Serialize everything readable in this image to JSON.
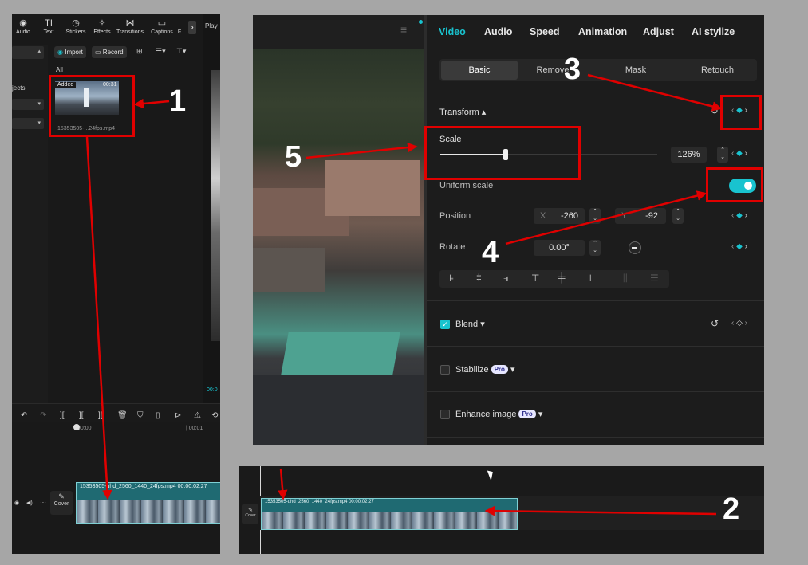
{
  "left_panel": {
    "toolbar": [
      {
        "label": "Audio",
        "icon": "audio-icon",
        "glyph": "◉"
      },
      {
        "label": "Text",
        "icon": "text-icon",
        "glyph": "TI"
      },
      {
        "label": "Stickers",
        "icon": "stickers-icon",
        "glyph": "◷"
      },
      {
        "label": "Effects",
        "icon": "effects-icon",
        "glyph": "✧"
      },
      {
        "label": "Transitions",
        "icon": "transitions-icon",
        "glyph": "⋈"
      },
      {
        "label": "Captions",
        "icon": "captions-icon",
        "glyph": "▭"
      },
      {
        "label": "F",
        "icon": "filters-icon",
        "glyph": ""
      }
    ],
    "next_glyph": "›",
    "import_label": "Import",
    "record_label": "Record",
    "all_label": "All",
    "sidebar_text": "jects",
    "player_label": "Play",
    "clip_badge": "Added",
    "clip_duration": "00:31",
    "clip_name": "15353505-...24fps.mp4",
    "timeline_time_start": "00:00",
    "timeline_time_next": "| 00:01",
    "player_time": "00:0",
    "cover_label": "Cover",
    "track_clip_label": "15353505-uhd_2560_1440_24fps.mp4  00:00:02:27"
  },
  "right_panel": {
    "tabs": [
      "Video",
      "Audio",
      "Speed",
      "Animation",
      "Adjust",
      "AI stylize"
    ],
    "active_tab": "Video",
    "subtabs": [
      "Basic",
      "Remove",
      "Mask",
      "Retouch"
    ],
    "active_subtab": "Basic",
    "transform_label": "Transform ▴",
    "scale_label": "Scale",
    "scale_value": "126%",
    "scale_level": 0.3,
    "uniform_scale_label": "Uniform scale",
    "uniform_scale_on": true,
    "position_label": "Position",
    "position_x_label": "X",
    "position_x": "-260",
    "position_y_label": "Y",
    "position_y": "-92",
    "rotate_label": "Rotate",
    "rotate_value": "0.00°",
    "blend_label": "Blend",
    "stabilize_label": "Stabilize",
    "enhance_label": "Enhance image",
    "pro_badge": "Pro",
    "accent_color": "#19c3cf"
  },
  "bottom_panel": {
    "track_clip_label": "15353505-uhd_2560_1440_24fps.mp4  00:00:02:27",
    "cover_label": "Cover"
  },
  "annotations": {
    "numbers": [
      "1",
      "2",
      "3",
      "4",
      "5"
    ],
    "color": "#e00000"
  }
}
